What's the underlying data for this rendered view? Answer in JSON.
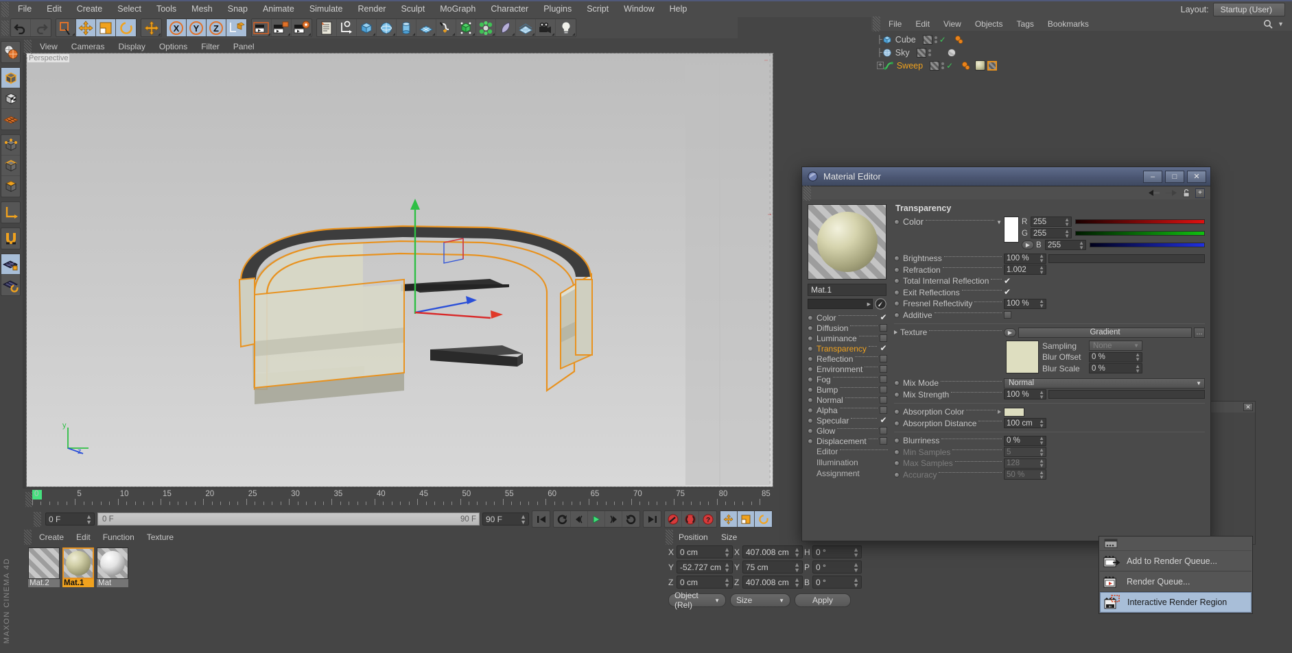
{
  "app": {
    "title": "CINEMA 4D",
    "brand_top": "MAXON",
    "layout_label": "Layout:",
    "layout_value": "Startup (User)"
  },
  "menubar": {
    "items": [
      "File",
      "Edit",
      "Create",
      "Select",
      "Tools",
      "Mesh",
      "Snap",
      "Animate",
      "Simulate",
      "Render",
      "Sculpt",
      "MoGraph",
      "Character",
      "Plugins",
      "Script",
      "Window",
      "Help"
    ]
  },
  "viewport": {
    "menu": [
      "View",
      "Cameras",
      "Display",
      "Options",
      "Filter",
      "Panel"
    ],
    "label": "Perspective"
  },
  "timeline": {
    "ticks": [
      "0",
      "5",
      "10",
      "15",
      "20",
      "25",
      "30",
      "35",
      "40",
      "45",
      "50",
      "55",
      "60",
      "65",
      "70",
      "75",
      "80",
      "85"
    ],
    "current_frame": "0 F",
    "current_frame_field": "0 F",
    "end_preview": "90 F",
    "end_frame": "90 F"
  },
  "material_manager": {
    "menu": [
      "Create",
      "Edit",
      "Function",
      "Texture"
    ],
    "materials": [
      {
        "name": "Mat.2",
        "selected": false,
        "kind": "checker"
      },
      {
        "name": "Mat.1",
        "selected": true,
        "kind": "olive"
      },
      {
        "name": "Mat",
        "selected": false,
        "kind": "white"
      }
    ]
  },
  "coordinates": {
    "headers": [
      "Position",
      "Size"
    ],
    "rows": [
      {
        "axis": "X",
        "position": "0 cm",
        "size_axis": "X",
        "size": "407.008 cm",
        "rot_axis": "H",
        "rotation": "0 °"
      },
      {
        "axis": "Y",
        "position": "-52.727 cm",
        "size_axis": "Y",
        "size": "75 cm",
        "rot_axis": "P",
        "rotation": "0 °"
      },
      {
        "axis": "Z",
        "position": "0 cm",
        "size_axis": "Z",
        "size": "407.008 cm",
        "rot_axis": "B",
        "rotation": "0 °"
      }
    ],
    "mode_select": "Object (Rel)",
    "size_select": "Size",
    "apply_label": "Apply"
  },
  "object_manager": {
    "menu": [
      "File",
      "Edit",
      "View",
      "Objects",
      "Tags",
      "Bookmarks"
    ],
    "objects": [
      {
        "name": "Cube",
        "icon": "cube-icon",
        "active": false,
        "visible_check": true,
        "tags": [
          "material-orange"
        ]
      },
      {
        "name": "Sky",
        "icon": "sky-icon",
        "active": false,
        "visible_check": false,
        "tags": [
          "sky-material"
        ]
      },
      {
        "name": "Sweep",
        "icon": "sweep-icon",
        "active": true,
        "visible_check": true,
        "tags": [
          "material-orange",
          "material-olive",
          "material-checker"
        ]
      }
    ]
  },
  "material_editor": {
    "window_title": "Material Editor",
    "window_buttons": {
      "minimize": "–",
      "maximize": "□",
      "close": "✕"
    },
    "material_name": "Mat.1",
    "search_placeholder": "",
    "channels": [
      {
        "label": "Color",
        "checked": true,
        "active": false
      },
      {
        "label": "Diffusion",
        "checked": false,
        "active": false
      },
      {
        "label": "Luminance",
        "checked": false,
        "active": false
      },
      {
        "label": "Transparency",
        "checked": true,
        "active": true
      },
      {
        "label": "Reflection",
        "checked": false,
        "active": false
      },
      {
        "label": "Environment",
        "checked": false,
        "active": false
      },
      {
        "label": "Fog",
        "checked": false,
        "active": false
      },
      {
        "label": "Bump",
        "checked": false,
        "active": false
      },
      {
        "label": "Normal",
        "checked": false,
        "active": false
      },
      {
        "label": "Alpha",
        "checked": false,
        "active": false
      },
      {
        "label": "Specular",
        "checked": true,
        "active": false
      },
      {
        "label": "Glow",
        "checked": false,
        "active": false
      },
      {
        "label": "Displacement",
        "checked": false,
        "active": false
      }
    ],
    "channel_pages": [
      "Editor",
      "Illumination",
      "Assignment"
    ],
    "section_title": "Transparency",
    "color": {
      "label": "Color",
      "swatch_hex": "#ffffff",
      "channels": [
        {
          "name": "R",
          "value": "255",
          "track_hex": "#e01010"
        },
        {
          "name": "G",
          "value": "255",
          "track_hex": "#10c010"
        },
        {
          "name": "B",
          "value": "255",
          "track_hex": "#2030e0"
        }
      ]
    },
    "params": [
      {
        "label": "Brightness",
        "value": "100 %",
        "type": "slider",
        "fill": 100
      },
      {
        "label": "Refraction",
        "value": "1.002",
        "type": "number"
      },
      {
        "label": "Total Internal Reflection",
        "value": "",
        "type": "check",
        "checked": true
      },
      {
        "label": "Exit Reflections",
        "value": "",
        "type": "check",
        "checked": true
      },
      {
        "label": "Fresnel Reflectivity",
        "value": "100 %",
        "type": "number"
      },
      {
        "label": "Additive",
        "value": "",
        "type": "check",
        "checked": false
      }
    ],
    "texture": {
      "label": "Texture",
      "value": "Gradient",
      "preview_hex": "#dedec0",
      "sampling_label": "Sampling",
      "sampling_value": "None",
      "blur_offset_label": "Blur Offset",
      "blur_offset_value": "0 %",
      "blur_scale_label": "Blur Scale",
      "blur_scale_value": "0 %"
    },
    "mix": [
      {
        "label": "Mix Mode",
        "value": "Normal",
        "type": "combo"
      },
      {
        "label": "Mix Strength",
        "value": "100 %",
        "type": "slider",
        "fill": 100
      }
    ],
    "absorption": [
      {
        "label": "Absorption Color",
        "value": "",
        "type": "color",
        "hex": "#dedec0"
      },
      {
        "label": "Absorption Distance",
        "value": "100 cm",
        "type": "number"
      }
    ],
    "blur": [
      {
        "label": "Blurriness",
        "value": "0 %",
        "type": "number",
        "dim": false
      },
      {
        "label": "Min Samples",
        "value": "5",
        "type": "number",
        "dim": true
      },
      {
        "label": "Max Samples",
        "value": "128",
        "type": "number",
        "dim": true
      },
      {
        "label": "Accuracy",
        "value": "50 %",
        "type": "number",
        "dim": true
      }
    ]
  },
  "context_menu": {
    "items": [
      {
        "label": "Add to Render Queue...",
        "icon": "render-queue-add-icon",
        "highlighted": false
      },
      {
        "label": "Render Queue...",
        "icon": "render-queue-icon",
        "highlighted": false
      },
      {
        "label": "Interactive Render Region",
        "icon": "irr-icon",
        "highlighted": true
      }
    ]
  },
  "colors": {
    "accent": "#f0a21e",
    "selection": "#a8bed8",
    "title_blue": "#4b5672",
    "panel": "#454545"
  }
}
